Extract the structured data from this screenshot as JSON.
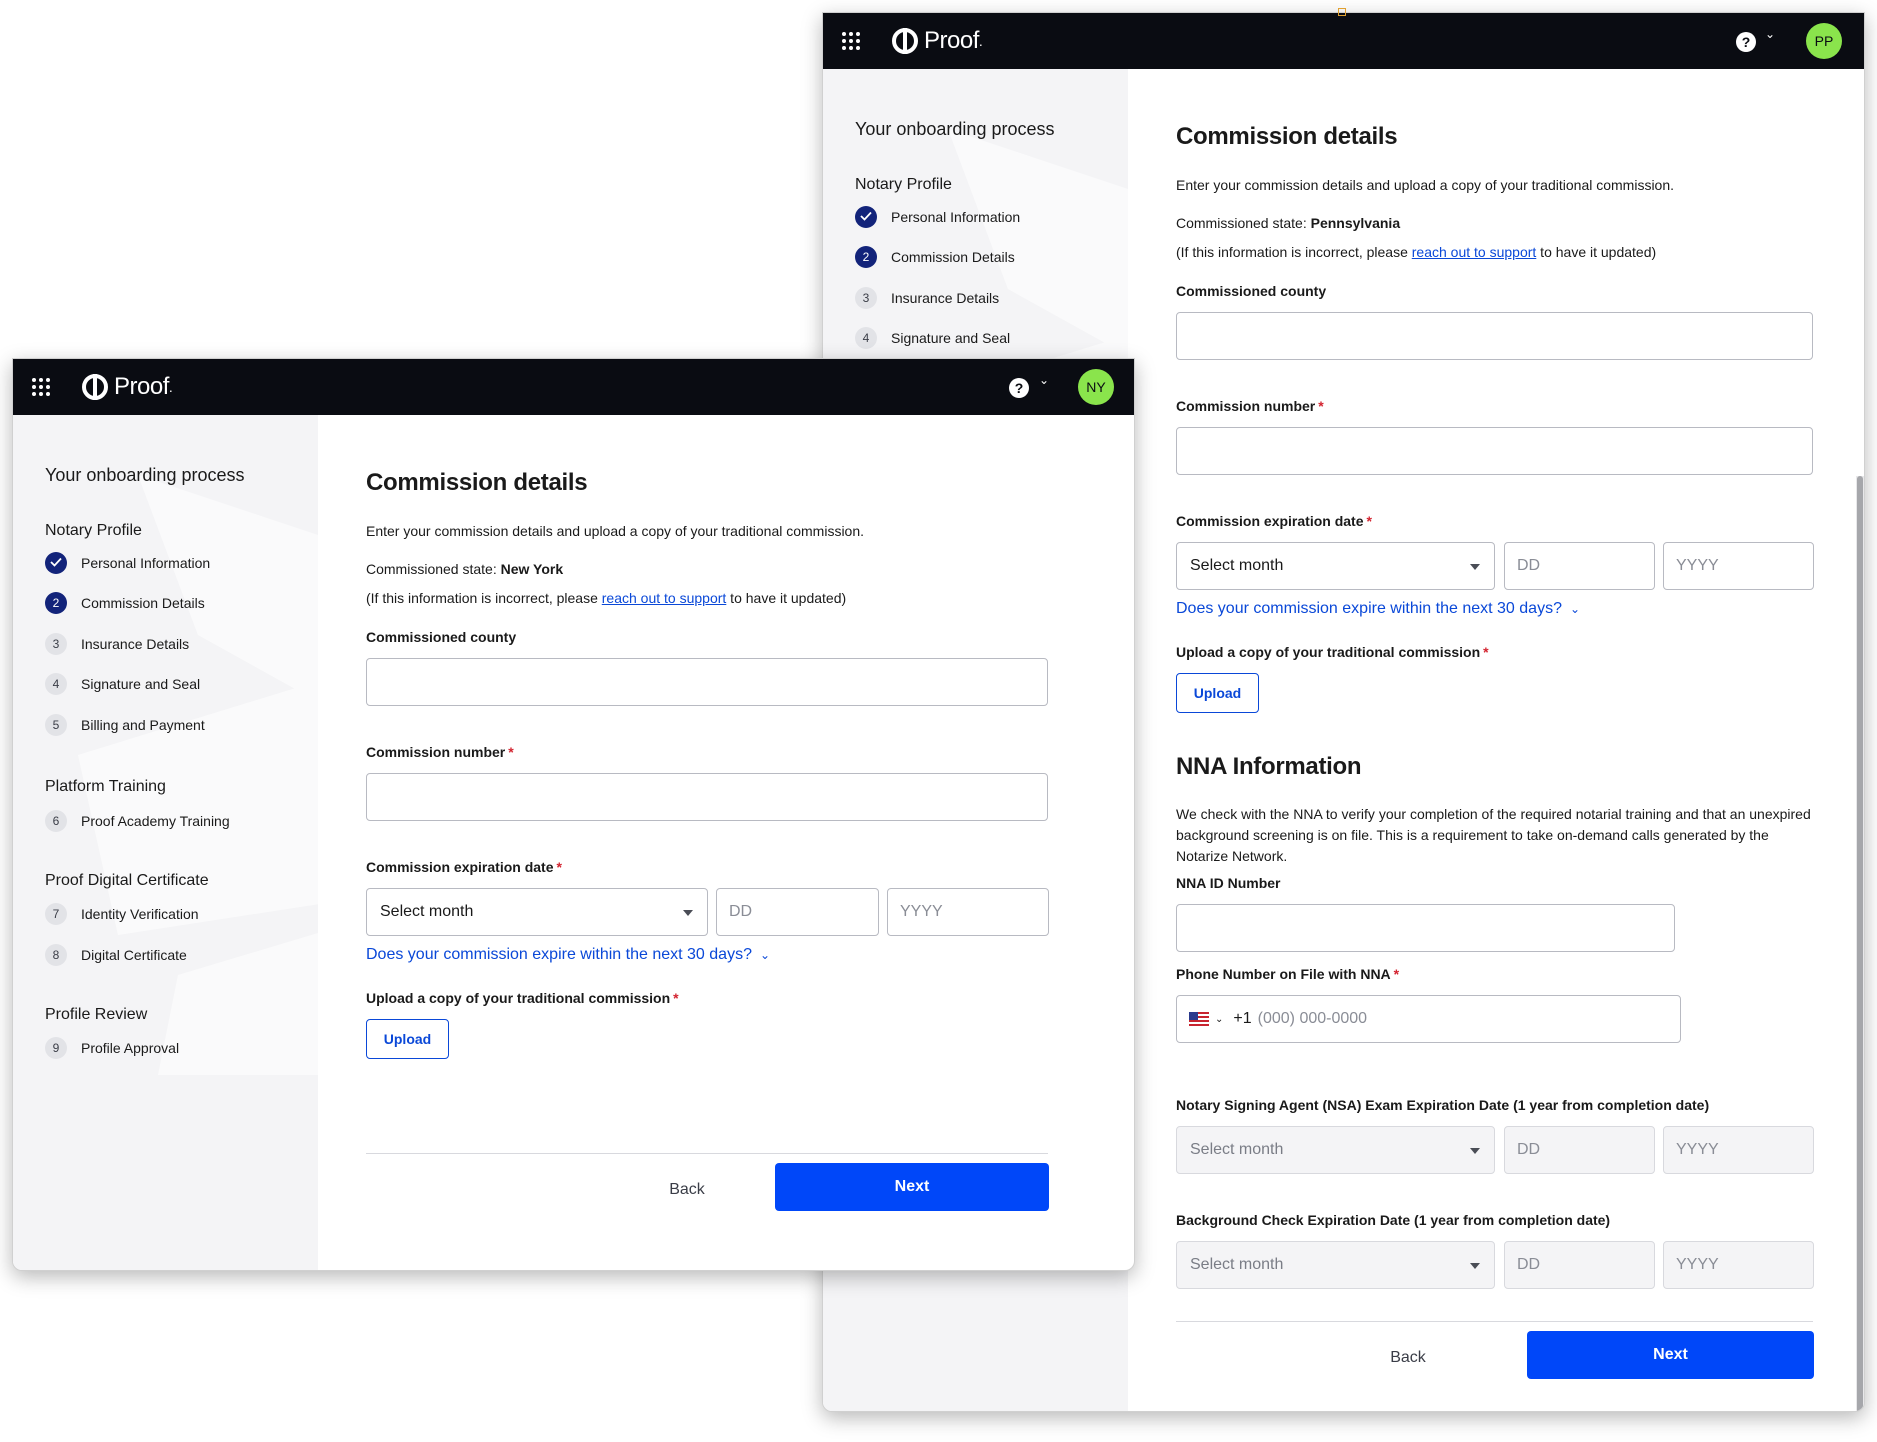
{
  "brand": {
    "name": "Proof",
    "trademark": ".",
    "help_label": "?",
    "chevron": "⌄"
  },
  "sidebar": {
    "title": "Your onboarding process",
    "sections": [
      {
        "title": "Notary Profile",
        "steps": [
          {
            "num": "1",
            "label": "Personal Information",
            "state": "done"
          },
          {
            "num": "2",
            "label": "Commission Details",
            "state": "active"
          },
          {
            "num": "3",
            "label": "Insurance Details",
            "state": "todo"
          },
          {
            "num": "4",
            "label": "Signature and Seal",
            "state": "todo"
          },
          {
            "num": "5",
            "label": "Billing and Payment",
            "state": "todo"
          }
        ]
      },
      {
        "title": "Platform Training",
        "steps": [
          {
            "num": "6",
            "label": "Proof Academy Training",
            "state": "todo"
          }
        ]
      },
      {
        "title": "Proof Digital Certificate",
        "steps": [
          {
            "num": "7",
            "label": "Identity Verification",
            "state": "todo"
          },
          {
            "num": "8",
            "label": "Digital Certificate",
            "state": "todo"
          }
        ]
      },
      {
        "title": "Profile Review",
        "steps": [
          {
            "num": "9",
            "label": "Profile Approval",
            "state": "todo"
          }
        ]
      }
    ]
  },
  "form": {
    "title": "Commission details",
    "intro": "Enter your commission details and upload a copy of your traditional commission.",
    "state_label": "Commissioned state:",
    "incorrect_prefix": "(If this information is incorrect, please ",
    "incorrect_link": "reach out to support",
    "incorrect_suffix": " to have it updated)",
    "county_label": "Commissioned county",
    "number_label": "Commission number",
    "required_mark": "*",
    "expiration_label": "Commission expiration date",
    "month_placeholder": "Select month",
    "day_placeholder": "DD",
    "year_placeholder": "YYYY",
    "expire_soon": "Does your commission expire within the next 30 days?",
    "expire_chevron": "⌄",
    "upload_label": "Upload a copy of your traditional commission",
    "upload_button": "Upload",
    "back_button": "Back",
    "next_button": "Next"
  },
  "window_front": {
    "state": "New York",
    "avatar": "NY"
  },
  "window_back": {
    "state": "Pennsylvania",
    "avatar": "PP",
    "nna": {
      "title": "NNA Information",
      "intro": "We check with the NNA to verify your completion of the required notarial training and that an unexpired background screening is on file. This is a requirement to take on-demand calls generated by the Notarize Network.",
      "id_label": "NNA ID Number",
      "phone_label": "Phone Number on File with NNA",
      "phone_code": "+1",
      "phone_placeholder": "(000) 000-0000",
      "nsa_label": "Notary Signing Agent (NSA) Exam Expiration Date (1 year from completion date)",
      "bg_label": "Background Check Expiration Date (1 year from completion date)"
    }
  },
  "colors": {
    "topbar": "#0a0c12",
    "primary": "#0047f9",
    "link": "#0a48d8",
    "step_active": "#12237a",
    "avatar": "#8ae44c",
    "required": "#d3232f"
  }
}
